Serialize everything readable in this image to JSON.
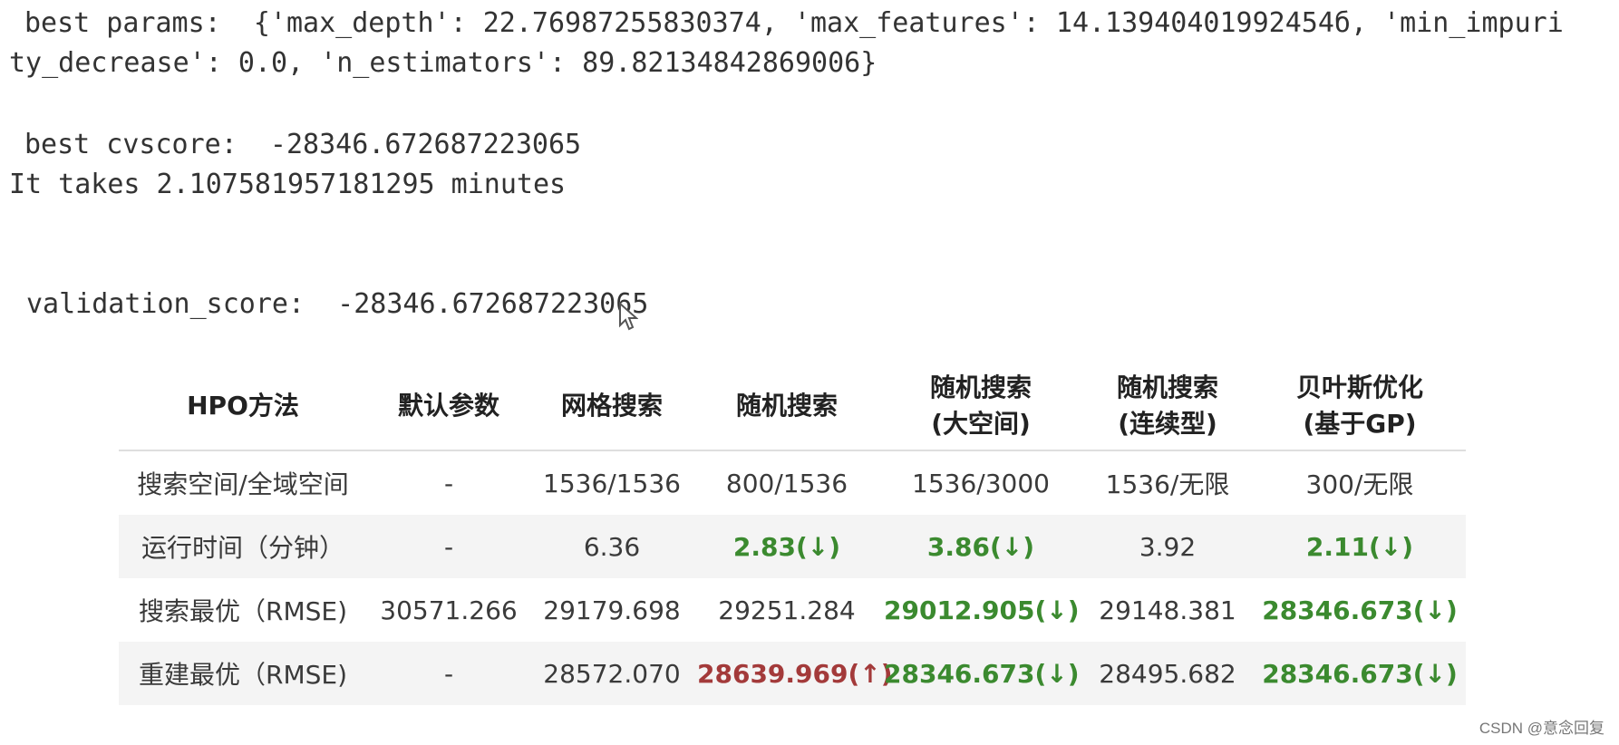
{
  "output": {
    "line1": "best params:  {'max_depth': 22.76987255830374, 'max_features': 14.13940401992454б, 'min_impuri",
    "line2": "ty_decrease': 0.0, 'n_estimators': 89.82134842869006}",
    "line3": "best cvscore:  -28346.672687223065",
    "line4": "It takes 2.107581957181295 minutes",
    "line5": "validation_score:  -28346.672687223065"
  },
  "table": {
    "headers": {
      "h0": "HPO方法",
      "h1": "默认参数",
      "h2": "网格搜索",
      "h3": "随机搜索",
      "h4a": "随机搜索",
      "h4b": "(大空间)",
      "h5a": "随机搜索",
      "h5b": "(连续型)",
      "h6a": "贝叶斯优化",
      "h6b": "(基于GP)"
    },
    "rows": [
      {
        "label": "搜索空间/全域空间",
        "c1": "-",
        "c2": "1536/1536",
        "c3": "800/1536",
        "c4": "1536/3000",
        "c5": "1536/无限",
        "c6": "300/无限"
      },
      {
        "label": "运行时间（分钟）",
        "c1": "-",
        "c2": "6.36",
        "c3": "2.83(↓)",
        "c4": "3.86(↓)",
        "c5": "3.92",
        "c6": "2.11(↓)"
      },
      {
        "label": "搜索最优（RMSE)",
        "c1": "30571.266",
        "c2": "29179.698",
        "c3": "29251.284",
        "c4": "29012.905(↓)",
        "c5": "29148.381",
        "c6": "28346.673(↓)"
      },
      {
        "label": "重建最优（RMSE)",
        "c1": "-",
        "c2": "28572.070",
        "c3": "28639.969(↑)",
        "c4": "28346.673(↓)",
        "c5": "28495.682",
        "c6": "28346.673(↓)"
      }
    ]
  },
  "colors": {
    "better": "#3b8a2f",
    "worse": "#a33a3a"
  },
  "watermark": "CSDN @意念回复"
}
